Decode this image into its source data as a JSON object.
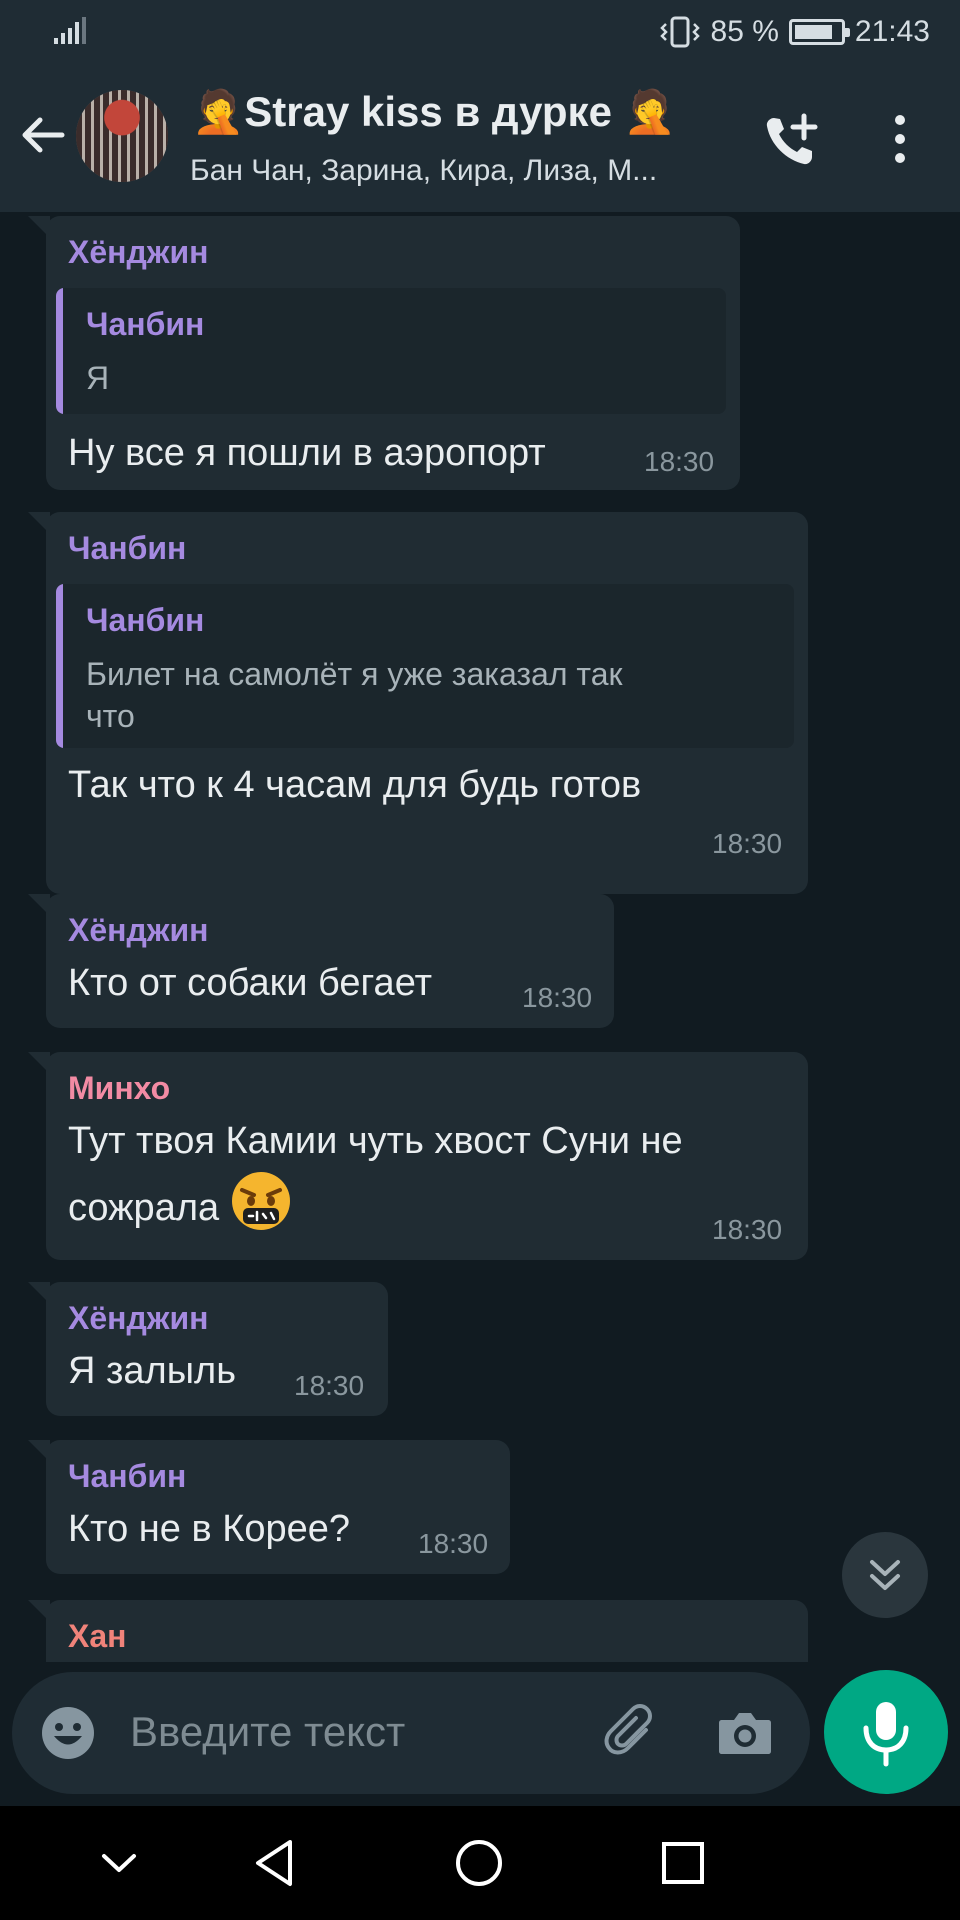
{
  "status_bar": {
    "battery_text": "85 %",
    "battery_level": 0.85,
    "time": "21:43"
  },
  "header": {
    "title": "🤦Stray kiss в дурке 🤦",
    "subtitle": "Бан Чан, Зарина, Кира, Лиза, М..."
  },
  "messages": [
    {
      "sender": "Хёнджин",
      "sender_color": "#a58ae0",
      "quote_sender": "Чанбин",
      "quote_lines": [
        "Я"
      ],
      "text_lines": [
        "Ну все я пошли в аэропорт"
      ],
      "time": "18:30"
    },
    {
      "sender": "Чанбин",
      "sender_color": "#a58ae0",
      "quote_sender": "Чанбин",
      "quote_lines": [
        "Билет на самолёт я уже заказал так",
        "что"
      ],
      "text_lines": [
        "Так что к 4 часам для будь готов"
      ],
      "time": "18:30"
    },
    {
      "sender": "Хёнджин",
      "sender_color": "#a58ae0",
      "text_lines": [
        "Кто от собаки бегает"
      ],
      "time": "18:30"
    },
    {
      "sender": "Минхо",
      "sender_color": "#f28ba4",
      "text_lines": [
        "Тут твоя Камии чуть хвост Суни не",
        "сожрала"
      ],
      "emoji": "face-with-symbols-on-mouth",
      "time": "18:30"
    },
    {
      "sender": "Хёнджин",
      "sender_color": "#a58ae0",
      "text_lines": [
        "Я залыль"
      ],
      "time": "18:30"
    },
    {
      "sender": "Чанбин",
      "sender_color": "#a58ae0",
      "text_lines": [
        "Кто не в Корее?"
      ],
      "time": "18:30"
    },
    {
      "sender": "Хан",
      "sender_color": "#f0837a"
    }
  ],
  "input": {
    "placeholder": "Введите текст"
  },
  "icons": {
    "back": "arrow-left-icon",
    "call_add": "phone-plus-icon",
    "more": "more-vertical-icon",
    "emoji": "emoji-icon",
    "attach": "paperclip-icon",
    "camera": "camera-icon",
    "mic": "microphone-icon",
    "scroll": "chevrons-down-icon"
  },
  "colors": {
    "accent": "#00a884",
    "bubble": "#202c33",
    "background": "#111b21"
  }
}
